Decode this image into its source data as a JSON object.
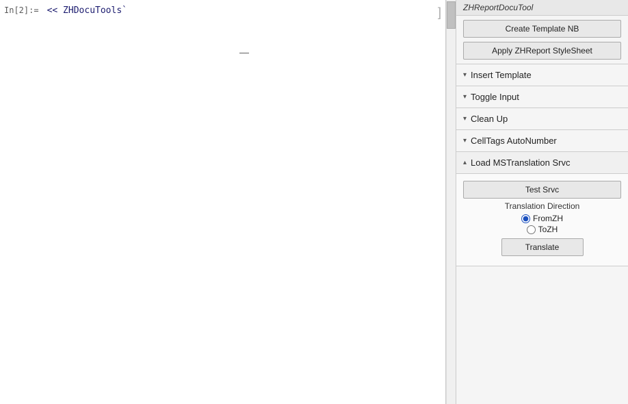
{
  "notebook": {
    "cell_label": "In[2]:=",
    "cell_content": "<< ZHDocuTools`",
    "bracket_symbol": "]"
  },
  "sidebar": {
    "title": "ZHReportDocuTool",
    "buttons": {
      "create_template": "Create Template NB",
      "apply_stylesheet": "Apply ZHReport StyleSheet"
    },
    "sections": [
      {
        "id": "insert-template",
        "label": "Insert Template",
        "chevron": "▾",
        "expanded": false
      },
      {
        "id": "toggle-input",
        "label": "Toggle Input",
        "chevron": "▾",
        "expanded": false
      },
      {
        "id": "clean-up",
        "label": "Clean Up",
        "chevron": "▾",
        "expanded": false
      },
      {
        "id": "celltags-autonumber",
        "label": "CellTags AutoNumber",
        "chevron": "▾",
        "expanded": false
      },
      {
        "id": "load-mstranslation",
        "label": "Load MSTranslation Srvc",
        "chevron": "▴",
        "expanded": true
      }
    ],
    "translation_section": {
      "test_btn": "Test Srvc",
      "direction_label": "Translation Direction",
      "from_zh_label": "FromZH",
      "to_zh_label": "ToZH",
      "translate_btn": "Translate"
    }
  }
}
